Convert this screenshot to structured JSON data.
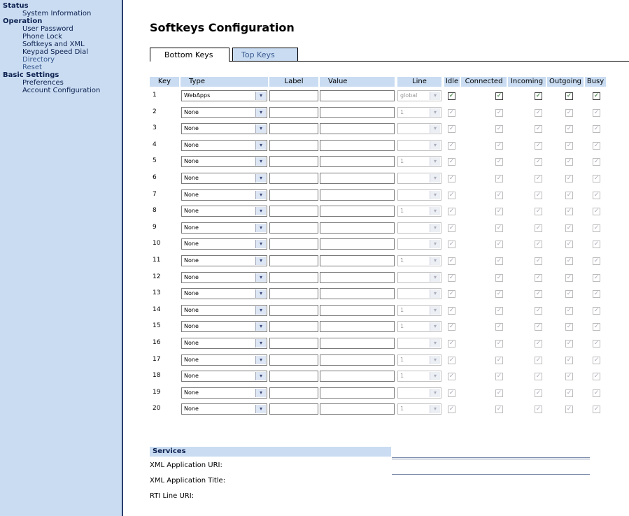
{
  "sidebar": {
    "groups": [
      {
        "label": "Status",
        "items": [
          "System Information"
        ]
      },
      {
        "label": "Operation",
        "items": [
          "User Password",
          "Phone Lock",
          "Softkeys and XML",
          "Keypad Speed Dial",
          "Directory",
          "Reset"
        ]
      },
      {
        "label": "Basic Settings",
        "items": [
          "Preferences",
          "Account Configuration"
        ]
      }
    ]
  },
  "page": {
    "title": "Softkeys Configuration"
  },
  "tabs": [
    {
      "label": "Bottom Keys",
      "active": true
    },
    {
      "label": "Top Keys",
      "active": false
    }
  ],
  "table": {
    "headers": {
      "key": "Key",
      "type": "Type",
      "label": "Label",
      "value": "Value",
      "line": "Line",
      "idle": "Idle",
      "connected": "Connected",
      "incoming": "Incoming",
      "outgoing": "Outgoing",
      "busy": "Busy"
    },
    "rows": [
      {
        "key": "1",
        "type": "WebApps",
        "line": "global",
        "states": [
          true,
          true,
          true,
          true,
          true
        ]
      },
      {
        "key": "2",
        "type": "None",
        "line": "1",
        "states": [
          false,
          false,
          false,
          false,
          false
        ]
      },
      {
        "key": "3",
        "type": "None",
        "line": "",
        "states": [
          false,
          false,
          false,
          false,
          false
        ]
      },
      {
        "key": "4",
        "type": "None",
        "line": "",
        "states": [
          false,
          false,
          false,
          false,
          false
        ]
      },
      {
        "key": "5",
        "type": "None",
        "line": "1",
        "states": [
          false,
          false,
          false,
          false,
          false
        ]
      },
      {
        "key": "6",
        "type": "None",
        "line": "",
        "states": [
          false,
          false,
          false,
          false,
          false
        ]
      },
      {
        "key": "7",
        "type": "None",
        "line": "",
        "states": [
          false,
          false,
          false,
          false,
          false
        ]
      },
      {
        "key": "8",
        "type": "None",
        "line": "1",
        "states": [
          false,
          false,
          false,
          false,
          false
        ]
      },
      {
        "key": "9",
        "type": "None",
        "line": "",
        "states": [
          false,
          false,
          false,
          false,
          false
        ]
      },
      {
        "key": "10",
        "type": "None",
        "line": "",
        "states": [
          false,
          false,
          false,
          false,
          false
        ]
      },
      {
        "key": "11",
        "type": "None",
        "line": "1",
        "states": [
          false,
          false,
          false,
          false,
          false
        ]
      },
      {
        "key": "12",
        "type": "None",
        "line": "",
        "states": [
          false,
          false,
          false,
          false,
          false
        ]
      },
      {
        "key": "13",
        "type": "None",
        "line": "",
        "states": [
          false,
          false,
          false,
          false,
          false
        ]
      },
      {
        "key": "14",
        "type": "None",
        "line": "1",
        "states": [
          false,
          false,
          false,
          false,
          false
        ]
      },
      {
        "key": "15",
        "type": "None",
        "line": "1",
        "states": [
          false,
          false,
          false,
          false,
          false
        ]
      },
      {
        "key": "16",
        "type": "None",
        "line": "",
        "states": [
          false,
          false,
          false,
          false,
          false
        ]
      },
      {
        "key": "17",
        "type": "None",
        "line": "1",
        "states": [
          false,
          false,
          false,
          false,
          false
        ]
      },
      {
        "key": "18",
        "type": "None",
        "line": "1",
        "states": [
          false,
          false,
          false,
          false,
          false
        ]
      },
      {
        "key": "19",
        "type": "None",
        "line": "",
        "states": [
          false,
          false,
          false,
          false,
          false
        ]
      },
      {
        "key": "20",
        "type": "None",
        "line": "1",
        "states": [
          false,
          false,
          false,
          false,
          false
        ]
      }
    ]
  },
  "services": {
    "header": "Services",
    "fields": [
      {
        "label": "XML Application URI:",
        "value": ""
      },
      {
        "label": "XML Application Title:",
        "value": ""
      },
      {
        "label": "RTI Line URI:",
        "value": ""
      }
    ]
  },
  "colors": {
    "accent": "#c9dcf2",
    "nav_text": "#0d2150",
    "border": "#2a3d6e"
  }
}
